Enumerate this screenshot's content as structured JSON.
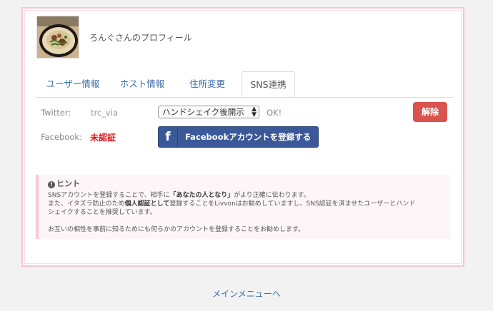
{
  "profile": {
    "title": "ろんぐさんのプロフィール"
  },
  "tabs": [
    {
      "label": "ユーザー情報",
      "active": false
    },
    {
      "label": "ホスト情報",
      "active": false
    },
    {
      "label": "住所変更",
      "active": false
    },
    {
      "label": "SNS連携",
      "active": true
    }
  ],
  "twitter": {
    "label": "Twitter:",
    "handle": "trc_via",
    "select_value": "ハンドシェイク後開示",
    "status": "OK!",
    "release_label": "解除"
  },
  "facebook": {
    "label": "Facebook:",
    "status": "未認証",
    "button_label": "Facebookアカウントを登録する",
    "icon": "f"
  },
  "hint": {
    "title": "ヒント",
    "line1_prefix": "SNSアカウントを登録することで、相手に",
    "line1_bold": "「あなたの人となり」",
    "line1_suffix": "がより正確に伝わります。",
    "line2_prefix": "また、イタズラ防止のため",
    "line2_bold": "個人認証として",
    "line2_suffix": "登録することをLivvonはお勧めしていますし、SNS認証を済ませたユーザーとハンド",
    "line3": "シェイクすることを推奨しています。",
    "line4": "お互いの相性を事前に知るためにも何らかのアカウントを登録することをお勧めします。"
  },
  "footer": {
    "main_menu_link": "メインメニューへ"
  },
  "colors": {
    "card_border": "#f5c6cf",
    "link": "#3a6ea5",
    "danger": "#d9534f",
    "facebook": "#3b5998",
    "unverified": "#e4161b",
    "hint_bg": "#fdf5f8"
  }
}
